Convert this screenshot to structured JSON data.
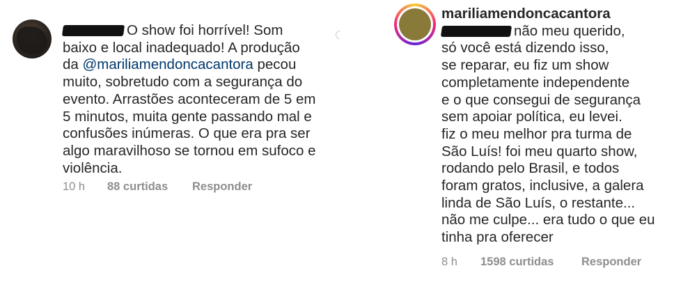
{
  "comment1": {
    "avatar_icon": "user-avatar-icon",
    "text_lines": [
      "O show foi horrível! Som",
      "baixo e local inadequado! A produção",
      "da ",
      "muito, sobretudo com a segurança do",
      "evento. Arrastões aconteceram de 5 em",
      "5 minutos, muita gente passando mal e",
      "confusões inúmeras. O que era pra ser",
      "algo maravilhoso se tornou em sufoco e",
      "violência."
    ],
    "mention": "@mariliamendoncacantora",
    "mention_suffix": " pecou",
    "time": "10 h",
    "likes": "88 curtidas",
    "reply": "Responder"
  },
  "comment2": {
    "avatar_icon": "profile-logo-icon",
    "username": "mariliamendoncacantora",
    "text_lines": [
      "não meu querido,",
      "só você está dizendo isso,",
      "se reparar, eu fiz um show",
      "completamente independente",
      "e o que consegui de segurança",
      "sem apoiar política, eu levei.",
      "fiz o meu melhor pra turma de",
      "São Luís! foi meu quarto show,",
      "rodando pelo Brasil, e todos",
      "foram gratos, inclusive, a galera",
      "linda de São Luís, o restante...",
      "não me culpe... era tudo o que eu",
      "tinha pra oferecer"
    ],
    "time": "8 h",
    "likes": "1598 curtidas",
    "reply": "Responder"
  },
  "loading_icon": "loading-spinner-icon",
  "colors": {
    "text": "#262626",
    "mention": "#00376b",
    "meta": "#8e8e8e"
  }
}
